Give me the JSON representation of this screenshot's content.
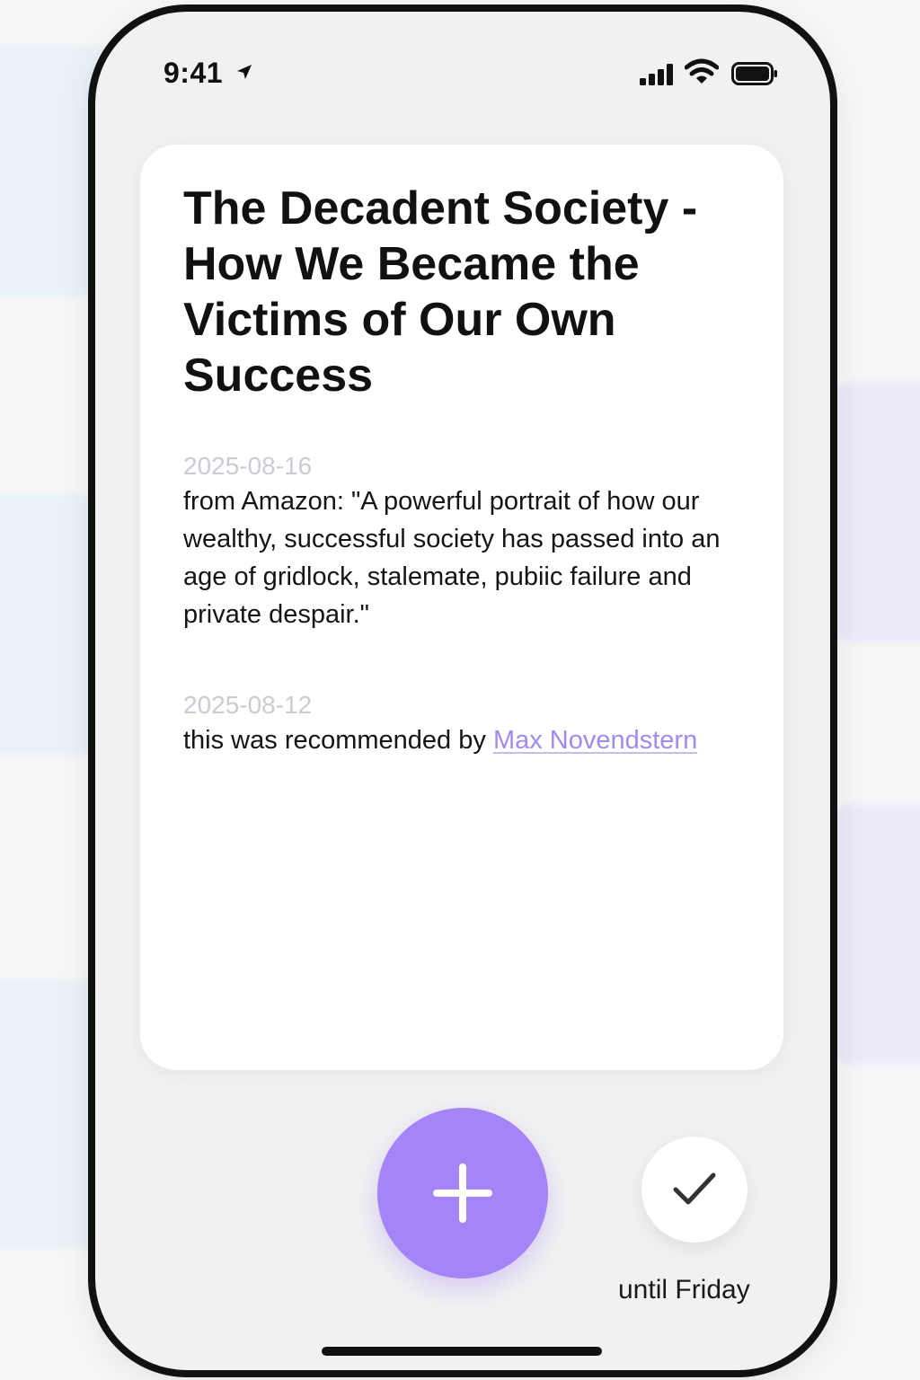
{
  "status_bar": {
    "time": "9:41"
  },
  "note": {
    "title": "The Decadent Society - How We Became the Victims of Our Own Success",
    "entries": [
      {
        "date": "2025-08-16",
        "text": "from Amazon: \"A powerful portrait of how our wealthy, successful society has passed into an age of gridlock, stalemate, pubiic failure and private despair.\""
      },
      {
        "date": "2025-08-12",
        "text_prefix": "this was recommended by ",
        "link_text": "Max Novendstern"
      }
    ]
  },
  "actions": {
    "add_icon": "plus-icon",
    "done_icon": "checkmark-icon",
    "done_caption": "until Friday"
  },
  "colors": {
    "accent": "#a484f6",
    "link": "#a18af0",
    "date": "#c9cdd3"
  }
}
